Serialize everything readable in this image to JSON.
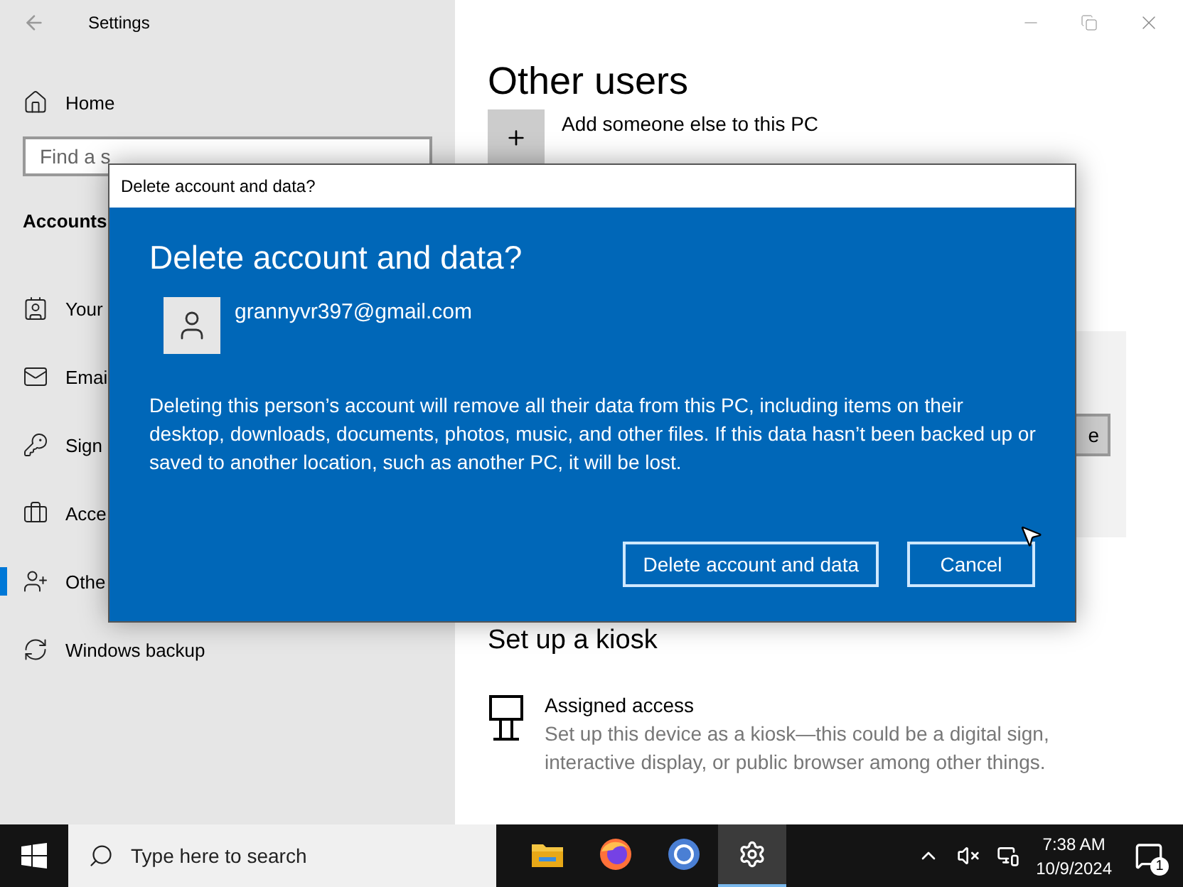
{
  "window": {
    "title": "Settings"
  },
  "sidebar": {
    "home": "Home",
    "search": {
      "placeholder": "Find a s"
    },
    "section": "Accounts",
    "items": [
      {
        "label": "Your",
        "kind": "profile",
        "selected": false
      },
      {
        "label": "Emai",
        "kind": "mail",
        "selected": false
      },
      {
        "label": "Sign",
        "kind": "key",
        "selected": false
      },
      {
        "label": "Acce",
        "kind": "briefcase",
        "selected": false
      },
      {
        "label": "Othe",
        "kind": "person-add",
        "selected": true
      },
      {
        "label": "Windows backup",
        "kind": "sync",
        "selected": false
      }
    ]
  },
  "content": {
    "heading": "Other users",
    "add_label": "Add someone else to this PC",
    "panel_button": "e",
    "kiosk_heading": "Set up a kiosk",
    "kiosk_item": {
      "title": "Assigned access",
      "description": "Set up this device as a kiosk—this could be a digital sign, interactive display, or public browser among other things."
    }
  },
  "dialog": {
    "title": "Delete account and data?",
    "heading": "Delete account and data?",
    "account": "grannyvr397@gmail.com",
    "message": "Deleting this person’s account will remove all their data from this PC, including items on their desktop, downloads, documents, photos, music, and other files. If this data hasn’t been backed up or saved to another location, such as another PC, it will be lost.",
    "buttons": [
      {
        "label": "Delete account and data"
      },
      {
        "label": "Cancel"
      }
    ]
  },
  "taskbar": {
    "search_placeholder": "Type here to search",
    "apps": [
      {
        "kind": "folder",
        "selected": false
      },
      {
        "kind": "firefox",
        "selected": false
      },
      {
        "kind": "chrome",
        "selected": false
      },
      {
        "kind": "settings",
        "selected": true
      }
    ],
    "time": "7:38 AM",
    "date": "10/9/2024",
    "notifications": "1"
  }
}
